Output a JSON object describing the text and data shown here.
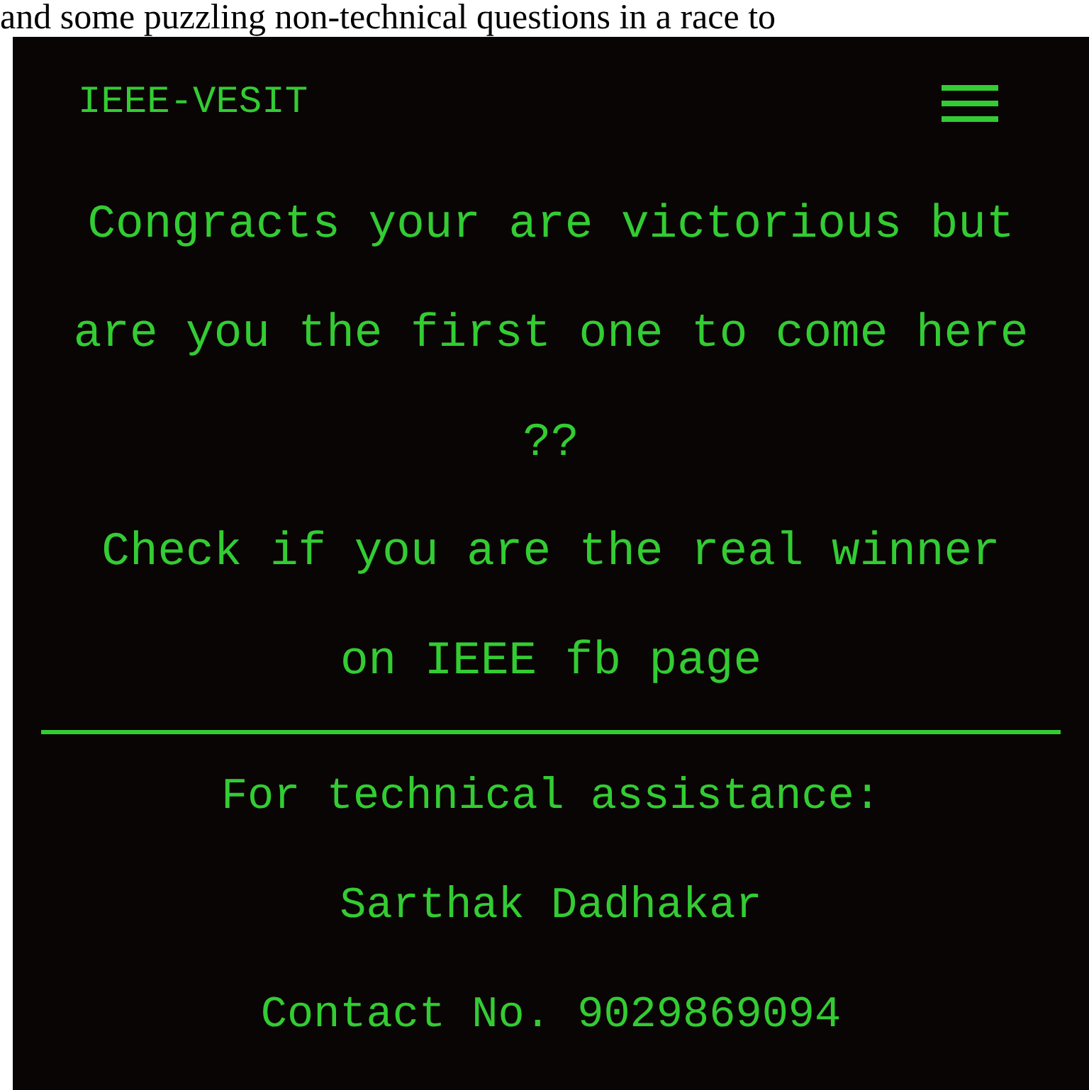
{
  "top_text": "and some puzzling non-technical questions in a race to",
  "header": {
    "brand": "IEEE-VESIT"
  },
  "message_lines": [
    "Congracts your are victorious but",
    "are you the first one to come here",
    "??",
    "Check if you are the real winner",
    "on IEEE fb page"
  ],
  "footer_lines": [
    "For technical assistance:",
    "Sarthak Dadhakar",
    "Contact No. 9029869094"
  ]
}
